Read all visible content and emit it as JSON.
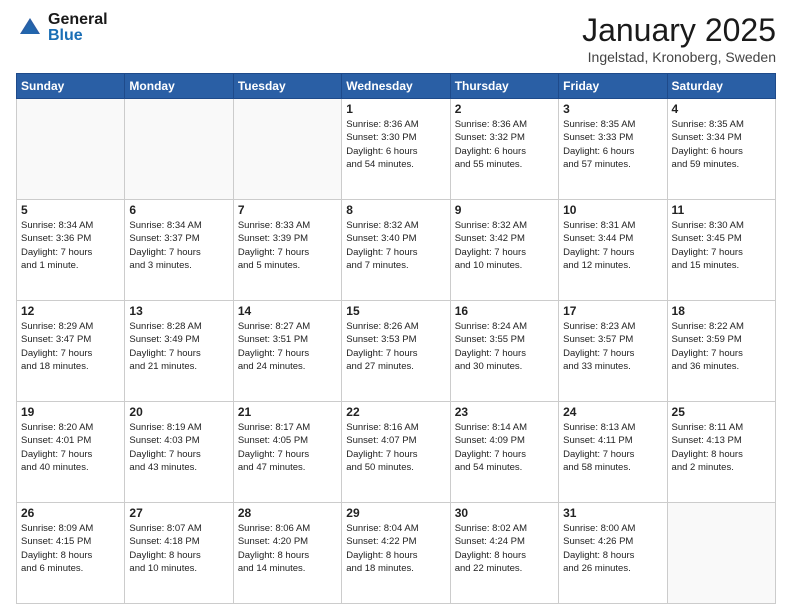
{
  "logo": {
    "general": "General",
    "blue": "Blue"
  },
  "header": {
    "month": "January 2025",
    "location": "Ingelstad, Kronoberg, Sweden"
  },
  "weekdays": [
    "Sunday",
    "Monday",
    "Tuesday",
    "Wednesday",
    "Thursday",
    "Friday",
    "Saturday"
  ],
  "weeks": [
    [
      {
        "day": "",
        "info": ""
      },
      {
        "day": "",
        "info": ""
      },
      {
        "day": "",
        "info": ""
      },
      {
        "day": "1",
        "info": "Sunrise: 8:36 AM\nSunset: 3:30 PM\nDaylight: 6 hours\nand 54 minutes."
      },
      {
        "day": "2",
        "info": "Sunrise: 8:36 AM\nSunset: 3:32 PM\nDaylight: 6 hours\nand 55 minutes."
      },
      {
        "day": "3",
        "info": "Sunrise: 8:35 AM\nSunset: 3:33 PM\nDaylight: 6 hours\nand 57 minutes."
      },
      {
        "day": "4",
        "info": "Sunrise: 8:35 AM\nSunset: 3:34 PM\nDaylight: 6 hours\nand 59 minutes."
      }
    ],
    [
      {
        "day": "5",
        "info": "Sunrise: 8:34 AM\nSunset: 3:36 PM\nDaylight: 7 hours\nand 1 minute."
      },
      {
        "day": "6",
        "info": "Sunrise: 8:34 AM\nSunset: 3:37 PM\nDaylight: 7 hours\nand 3 minutes."
      },
      {
        "day": "7",
        "info": "Sunrise: 8:33 AM\nSunset: 3:39 PM\nDaylight: 7 hours\nand 5 minutes."
      },
      {
        "day": "8",
        "info": "Sunrise: 8:32 AM\nSunset: 3:40 PM\nDaylight: 7 hours\nand 7 minutes."
      },
      {
        "day": "9",
        "info": "Sunrise: 8:32 AM\nSunset: 3:42 PM\nDaylight: 7 hours\nand 10 minutes."
      },
      {
        "day": "10",
        "info": "Sunrise: 8:31 AM\nSunset: 3:44 PM\nDaylight: 7 hours\nand 12 minutes."
      },
      {
        "day": "11",
        "info": "Sunrise: 8:30 AM\nSunset: 3:45 PM\nDaylight: 7 hours\nand 15 minutes."
      }
    ],
    [
      {
        "day": "12",
        "info": "Sunrise: 8:29 AM\nSunset: 3:47 PM\nDaylight: 7 hours\nand 18 minutes."
      },
      {
        "day": "13",
        "info": "Sunrise: 8:28 AM\nSunset: 3:49 PM\nDaylight: 7 hours\nand 21 minutes."
      },
      {
        "day": "14",
        "info": "Sunrise: 8:27 AM\nSunset: 3:51 PM\nDaylight: 7 hours\nand 24 minutes."
      },
      {
        "day": "15",
        "info": "Sunrise: 8:26 AM\nSunset: 3:53 PM\nDaylight: 7 hours\nand 27 minutes."
      },
      {
        "day": "16",
        "info": "Sunrise: 8:24 AM\nSunset: 3:55 PM\nDaylight: 7 hours\nand 30 minutes."
      },
      {
        "day": "17",
        "info": "Sunrise: 8:23 AM\nSunset: 3:57 PM\nDaylight: 7 hours\nand 33 minutes."
      },
      {
        "day": "18",
        "info": "Sunrise: 8:22 AM\nSunset: 3:59 PM\nDaylight: 7 hours\nand 36 minutes."
      }
    ],
    [
      {
        "day": "19",
        "info": "Sunrise: 8:20 AM\nSunset: 4:01 PM\nDaylight: 7 hours\nand 40 minutes."
      },
      {
        "day": "20",
        "info": "Sunrise: 8:19 AM\nSunset: 4:03 PM\nDaylight: 7 hours\nand 43 minutes."
      },
      {
        "day": "21",
        "info": "Sunrise: 8:17 AM\nSunset: 4:05 PM\nDaylight: 7 hours\nand 47 minutes."
      },
      {
        "day": "22",
        "info": "Sunrise: 8:16 AM\nSunset: 4:07 PM\nDaylight: 7 hours\nand 50 minutes."
      },
      {
        "day": "23",
        "info": "Sunrise: 8:14 AM\nSunset: 4:09 PM\nDaylight: 7 hours\nand 54 minutes."
      },
      {
        "day": "24",
        "info": "Sunrise: 8:13 AM\nSunset: 4:11 PM\nDaylight: 7 hours\nand 58 minutes."
      },
      {
        "day": "25",
        "info": "Sunrise: 8:11 AM\nSunset: 4:13 PM\nDaylight: 8 hours\nand 2 minutes."
      }
    ],
    [
      {
        "day": "26",
        "info": "Sunrise: 8:09 AM\nSunset: 4:15 PM\nDaylight: 8 hours\nand 6 minutes."
      },
      {
        "day": "27",
        "info": "Sunrise: 8:07 AM\nSunset: 4:18 PM\nDaylight: 8 hours\nand 10 minutes."
      },
      {
        "day": "28",
        "info": "Sunrise: 8:06 AM\nSunset: 4:20 PM\nDaylight: 8 hours\nand 14 minutes."
      },
      {
        "day": "29",
        "info": "Sunrise: 8:04 AM\nSunset: 4:22 PM\nDaylight: 8 hours\nand 18 minutes."
      },
      {
        "day": "30",
        "info": "Sunrise: 8:02 AM\nSunset: 4:24 PM\nDaylight: 8 hours\nand 22 minutes."
      },
      {
        "day": "31",
        "info": "Sunrise: 8:00 AM\nSunset: 4:26 PM\nDaylight: 8 hours\nand 26 minutes."
      },
      {
        "day": "",
        "info": ""
      }
    ]
  ]
}
